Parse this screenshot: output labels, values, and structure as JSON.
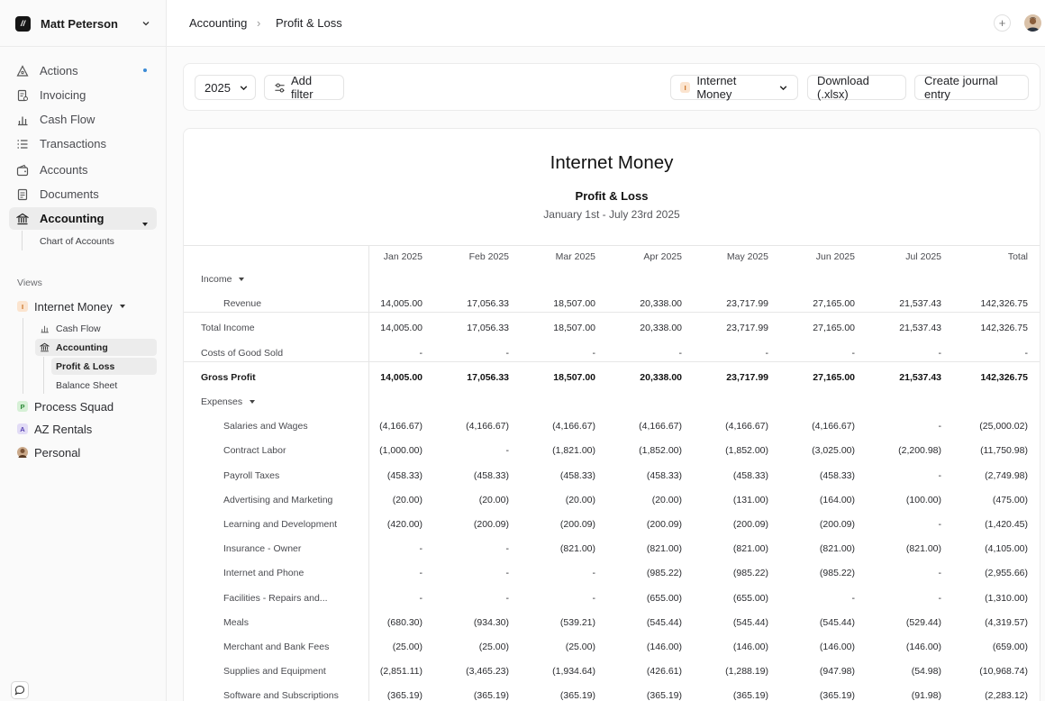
{
  "sidebar": {
    "user_name": "Matt Peterson",
    "logo_text": "//",
    "nav": [
      {
        "label": "Actions",
        "icon": "actions-icon"
      },
      {
        "label": "Invoicing",
        "icon": "invoice-icon"
      },
      {
        "label": "Cash Flow",
        "icon": "bar-chart-icon"
      },
      {
        "label": "Transactions",
        "icon": "list-icon"
      },
      {
        "label": "Accounts",
        "icon": "wallet-icon"
      },
      {
        "label": "Documents",
        "icon": "document-icon"
      },
      {
        "label": "Accounting",
        "icon": "bank-icon"
      }
    ],
    "accounting_sub": "Chart of Accounts",
    "views_label": "Views",
    "views": [
      {
        "label": "Internet Money",
        "badge": "I",
        "badge_color": "#fbe4cf",
        "badge_text_color": "#c76a1a"
      },
      {
        "label": "Process Squad",
        "badge": "P",
        "badge_color": "#d6f0d6",
        "badge_text_color": "#2f8a3a"
      },
      {
        "label": "AZ Rentals",
        "badge": "A",
        "badge_color": "#e2dcf6",
        "badge_text_color": "#5a45b3"
      },
      {
        "label": "Personal",
        "badge": "",
        "badge_color": "#caa98a",
        "badge_text_color": "#fff"
      }
    ],
    "view_sub": {
      "cash_flow": "Cash Flow",
      "accounting": "Accounting",
      "profit_loss": "Profit & Loss",
      "balance_sheet": "Balance Sheet"
    }
  },
  "header": {
    "crumb_1": "Accounting",
    "separator": "›",
    "crumb_2": "Profit & Loss",
    "plus": "+"
  },
  "filters": {
    "year": "2025",
    "add_filter": "Add filter",
    "entity": "Internet Money",
    "entity_badge": "I",
    "download": "Download (.xlsx)",
    "create_entry": "Create journal entry"
  },
  "report": {
    "company": "Internet Money",
    "title": "Profit & Loss",
    "range": "January 1st - July 23rd 2025",
    "columns": [
      "Jan 2025",
      "Feb 2025",
      "Mar 2025",
      "Apr 2025",
      "May 2025",
      "Jun 2025",
      "Jul 2025",
      "Total"
    ],
    "rows": [
      {
        "label": "Income",
        "kind": "section",
        "values": []
      },
      {
        "label": "Revenue",
        "kind": "child",
        "values": [
          "14,005.00",
          "17,056.33",
          "18,507.00",
          "20,338.00",
          "23,717.99",
          "27,165.00",
          "21,537.43",
          "142,326.75"
        ]
      },
      {
        "label": "Total Income",
        "kind": "plain",
        "values": [
          "14,005.00",
          "17,056.33",
          "18,507.00",
          "20,338.00",
          "23,717.99",
          "27,165.00",
          "21,537.43",
          "142,326.75"
        ]
      },
      {
        "label": "Costs of Good Sold",
        "kind": "plain",
        "values": [
          "-",
          "-",
          "-",
          "-",
          "-",
          "-",
          "-",
          "-"
        ]
      },
      {
        "label": "Gross Profit",
        "kind": "bold",
        "values": [
          "14,005.00",
          "17,056.33",
          "18,507.00",
          "20,338.00",
          "23,717.99",
          "27,165.00",
          "21,537.43",
          "142,326.75"
        ]
      },
      {
        "label": "Expenses",
        "kind": "section",
        "values": []
      },
      {
        "label": "Salaries and Wages",
        "kind": "child",
        "values": [
          "(4,166.67)",
          "(4,166.67)",
          "(4,166.67)",
          "(4,166.67)",
          "(4,166.67)",
          "(4,166.67)",
          "-",
          "(25,000.02)"
        ]
      },
      {
        "label": "Contract Labor",
        "kind": "child",
        "values": [
          "(1,000.00)",
          "-",
          "(1,821.00)",
          "(1,852.00)",
          "(1,852.00)",
          "(3,025.00)",
          "(2,200.98)",
          "(11,750.98)"
        ]
      },
      {
        "label": "Payroll Taxes",
        "kind": "child",
        "values": [
          "(458.33)",
          "(458.33)",
          "(458.33)",
          "(458.33)",
          "(458.33)",
          "(458.33)",
          "-",
          "(2,749.98)"
        ]
      },
      {
        "label": "Advertising and Marketing",
        "kind": "child",
        "values": [
          "(20.00)",
          "(20.00)",
          "(20.00)",
          "(20.00)",
          "(131.00)",
          "(164.00)",
          "(100.00)",
          "(475.00)"
        ]
      },
      {
        "label": "Learning and Development",
        "kind": "child",
        "values": [
          "(420.00)",
          "(200.09)",
          "(200.09)",
          "(200.09)",
          "(200.09)",
          "(200.09)",
          "-",
          "(1,420.45)"
        ]
      },
      {
        "label": "Insurance - Owner",
        "kind": "child",
        "values": [
          "-",
          "-",
          "(821.00)",
          "(821.00)",
          "(821.00)",
          "(821.00)",
          "(821.00)",
          "(4,105.00)"
        ]
      },
      {
        "label": "Internet and Phone",
        "kind": "child",
        "values": [
          "-",
          "-",
          "-",
          "(985.22)",
          "(985.22)",
          "(985.22)",
          "-",
          "(2,955.66)"
        ]
      },
      {
        "label": "Facilities - Repairs and...",
        "kind": "child",
        "values": [
          "-",
          "-",
          "-",
          "(655.00)",
          "(655.00)",
          "-",
          "-",
          "(1,310.00)"
        ]
      },
      {
        "label": "Meals",
        "kind": "child",
        "values": [
          "(680.30)",
          "(934.30)",
          "(539.21)",
          "(545.44)",
          "(545.44)",
          "(545.44)",
          "(529.44)",
          "(4,319.57)"
        ]
      },
      {
        "label": "Merchant and Bank Fees",
        "kind": "child",
        "values": [
          "(25.00)",
          "(25.00)",
          "(25.00)",
          "(146.00)",
          "(146.00)",
          "(146.00)",
          "(146.00)",
          "(659.00)"
        ]
      },
      {
        "label": "Supplies and Equipment",
        "kind": "child",
        "values": [
          "(2,851.11)",
          "(3,465.23)",
          "(1,934.64)",
          "(426.61)",
          "(1,288.19)",
          "(947.98)",
          "(54.98)",
          "(10,968.74)"
        ]
      },
      {
        "label": "Software and Subscriptions",
        "kind": "child",
        "values": [
          "(365.19)",
          "(365.19)",
          "(365.19)",
          "(365.19)",
          "(365.19)",
          "(365.19)",
          "(91.98)",
          "(2,283.12)"
        ]
      }
    ]
  },
  "colors": {
    "accent_dot": "#3b8bd6",
    "active_bg": "#ececec"
  }
}
